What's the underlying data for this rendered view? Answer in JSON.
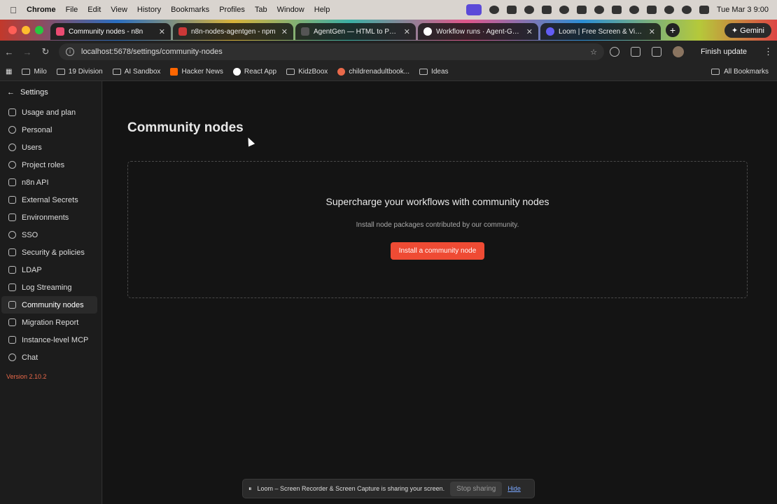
{
  "menubar": {
    "app": "Chrome",
    "items": [
      "File",
      "Edit",
      "View",
      "History",
      "Bookmarks",
      "Profiles",
      "Tab",
      "Window",
      "Help"
    ],
    "clock": "Tue Mar 3  9:00"
  },
  "tabs": [
    {
      "title": "Community nodes - n8n",
      "color": "#ea4b71",
      "active": true
    },
    {
      "title": "n8n-nodes-agentgen - npm",
      "color": "#cb3837",
      "active": false
    },
    {
      "title": "AgentGen — HTML to PDF & ...",
      "color": "#333333",
      "active": false
    },
    {
      "title": "Workflow runs · Agent-Gen-...",
      "color": "#ffffff",
      "active": false
    },
    {
      "title": "Loom | Free Screen & Video R...",
      "color": "#625df5",
      "active": false
    }
  ],
  "gemini_label": "Gemini",
  "address": {
    "url": "localhost:5678/settings/community-nodes"
  },
  "finish_update": "Finish update",
  "bookmarks": [
    {
      "label": "Milo",
      "type": "folder"
    },
    {
      "label": "19 Division",
      "type": "folder"
    },
    {
      "label": "AI Sandbox",
      "type": "folder"
    },
    {
      "label": "Hacker News",
      "type": "site",
      "color": "#ff6600"
    },
    {
      "label": "React App",
      "type": "site",
      "color": "#ffffff"
    },
    {
      "label": "KidzBoox",
      "type": "folder"
    },
    {
      "label": "childrenadultbook...",
      "type": "site",
      "color": "#e9694a"
    },
    {
      "label": "Ideas",
      "type": "folder"
    }
  ],
  "all_bookmarks": "All Bookmarks",
  "sidebar": {
    "back_label": "Settings",
    "items": [
      {
        "label": "Usage and plan",
        "icon": "chart-icon"
      },
      {
        "label": "Personal",
        "icon": "user-circle-icon"
      },
      {
        "label": "Users",
        "icon": "user-icon"
      },
      {
        "label": "Project roles",
        "icon": "user-icon"
      },
      {
        "label": "n8n API",
        "icon": "plug-icon"
      },
      {
        "label": "External Secrets",
        "icon": "vault-icon"
      },
      {
        "label": "Environments",
        "icon": "git-branch-icon"
      },
      {
        "label": "SSO",
        "icon": "user-lock-icon"
      },
      {
        "label": "Security & policies",
        "icon": "shield-icon"
      },
      {
        "label": "LDAP",
        "icon": "network-icon"
      },
      {
        "label": "Log Streaming",
        "icon": "log-icon"
      },
      {
        "label": "Community nodes",
        "icon": "box-icon",
        "active": true
      },
      {
        "label": "Migration Report",
        "icon": "list-icon"
      },
      {
        "label": "Instance-level MCP",
        "icon": "mcp-icon"
      },
      {
        "label": "Chat",
        "icon": "chat-icon"
      }
    ],
    "version": "Version 2.10.2"
  },
  "main": {
    "title": "Community nodes",
    "empty_title": "Supercharge your workflows with community nodes",
    "empty_desc": "Install node packages contributed by our community.",
    "cta_label": "Install a community node"
  },
  "sharebar": {
    "text": "Loom – Screen Recorder & Screen Capture is sharing your screen.",
    "stop_label": "Stop sharing",
    "hide_label": "Hide"
  }
}
